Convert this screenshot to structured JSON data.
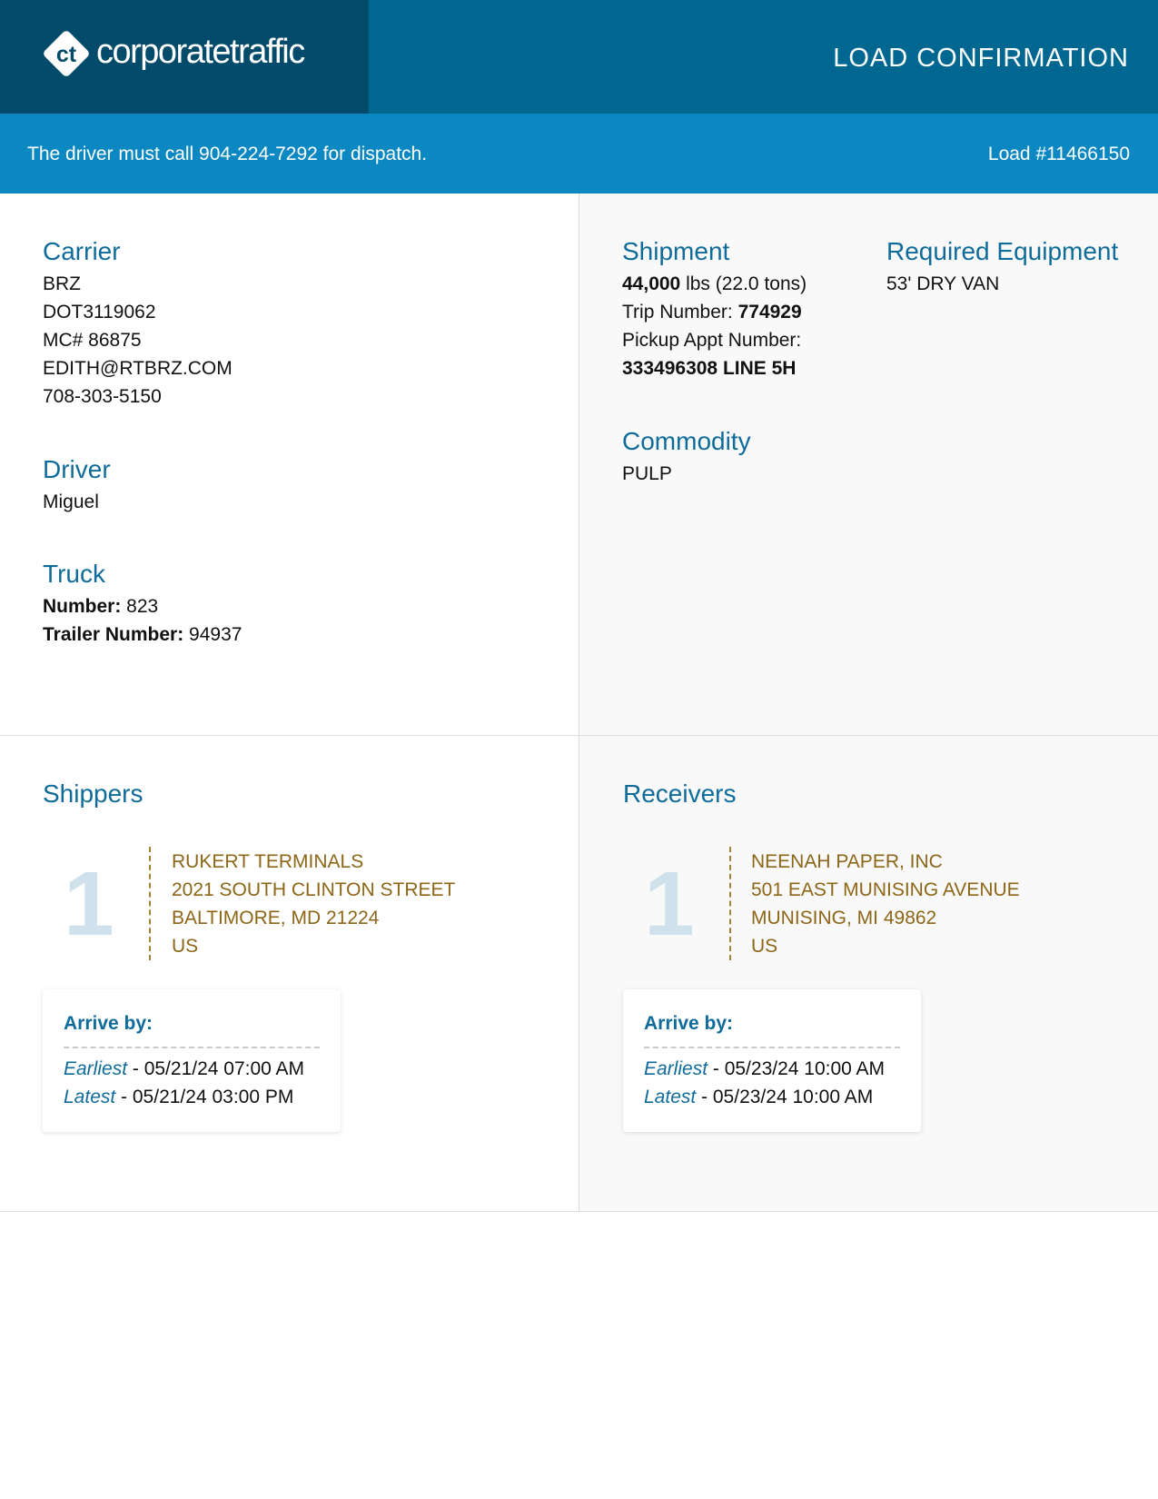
{
  "header": {
    "logo_mark": "ct",
    "logo_text": "corporatetraffic",
    "title": "LOAD CONFIRMATION",
    "colors": {
      "header": "#006791",
      "logo_box": "#034b6a",
      "dispatch_bar": "#0b88c2"
    }
  },
  "dispatch": {
    "message": "The driver must call 904-224-7292 for dispatch.",
    "load_number": "Load #11466150"
  },
  "carrier": {
    "title": "Carrier",
    "name": "BRZ",
    "dot": "DOT3119062",
    "mc": "MC# 86875",
    "email": "EDITH@RTBRZ.COM",
    "phone": "708-303-5150"
  },
  "driver": {
    "title": "Driver",
    "name": "Miguel"
  },
  "truck": {
    "title": "Truck",
    "number_label": "Number:",
    "number": " 823",
    "trailer_label": "Trailer Number:",
    "trailer": " 94937"
  },
  "shipment": {
    "title": "Shipment",
    "weight": "44,000",
    "weight_rest": " lbs (22.0 tons)",
    "trip_label": "Trip Number: ",
    "trip": "774929",
    "pickup_label": "Pickup Appt Number:",
    "pickup": "333496308 LINE 5H"
  },
  "equipment": {
    "title": "Required Equipment",
    "value": "53' DRY VAN"
  },
  "commodity": {
    "title": "Commodity",
    "value": "PULP"
  },
  "shippers": {
    "title": "Shippers",
    "stop_number": "1",
    "name": "RUKERT TERMINALS",
    "street": "2021 SOUTH CLINTON STREET",
    "city": "BALTIMORE, MD 21224",
    "country": "US",
    "arrive_label": "Arrive by:",
    "earliest_label": "Earliest",
    "earliest": " - 05/21/24 07:00 AM",
    "latest_label": "Latest",
    "latest": " - 05/21/24 03:00 PM"
  },
  "receivers": {
    "title": "Receivers",
    "stop_number": "1",
    "name": "NEENAH PAPER, INC",
    "street": "501 EAST MUNISING AVENUE",
    "city": "MUNISING, MI 49862",
    "country": "US",
    "arrive_label": "Arrive by:",
    "earliest_label": "Earliest",
    "earliest": " - 05/23/24 10:00 AM",
    "latest_label": "Latest",
    "latest": " - 05/23/24 10:00 AM"
  }
}
